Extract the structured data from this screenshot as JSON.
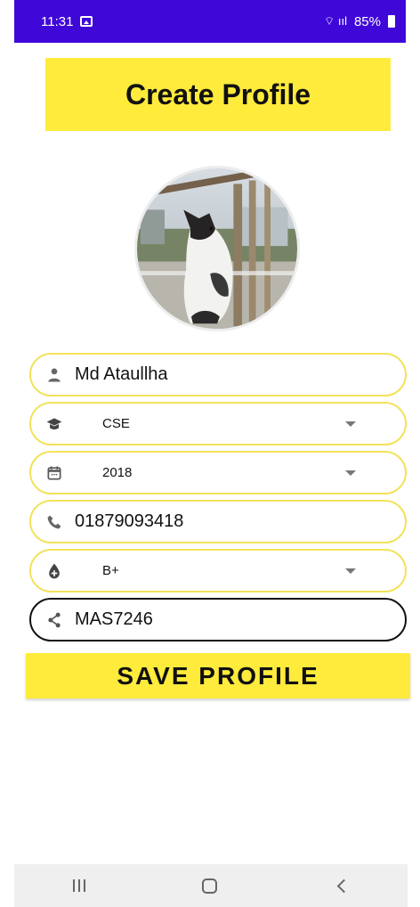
{
  "status_bar": {
    "time": "11:31",
    "battery": "85%",
    "background_color": "#3f08d8"
  },
  "header": {
    "title": "Create Profile",
    "color": "#ffeb3b"
  },
  "avatar": {
    "image": "cat-photo"
  },
  "form": {
    "name": {
      "value": "Md Ataullha",
      "icon": "person-icon"
    },
    "department": {
      "value": "CSE",
      "icon": "graduation-cap-icon"
    },
    "year": {
      "value": "2018",
      "icon": "calendar-icon"
    },
    "phone": {
      "value": "01879093418",
      "icon": "phone-icon"
    },
    "blood_group": {
      "value": "B+",
      "icon": "blood-drop-icon"
    },
    "share_code": {
      "value": "MAS7246",
      "icon": "share-icon"
    }
  },
  "actions": {
    "save_label": "SAVE PROFILE"
  },
  "colors": {
    "accent": "#ffeb3b",
    "field_border": "#f2e25a",
    "active_border": "#111111"
  }
}
